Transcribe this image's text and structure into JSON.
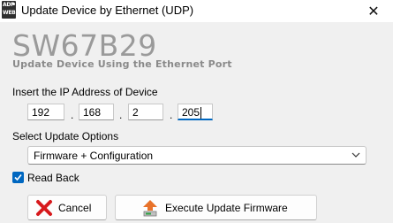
{
  "window": {
    "logo_line1": "ADF",
    "logo_line2": "WEB",
    "title": "Update Device by Ethernet (UDP)",
    "close_glyph": "✕"
  },
  "header": {
    "device": "SW67B29",
    "subtitle": "Update Device Using the Ethernet Port"
  },
  "ip": {
    "label": "Insert the IP Address of Device",
    "octets": [
      "192",
      "168",
      "2",
      "205"
    ],
    "separator": "."
  },
  "update_options": {
    "label": "Select Update Options",
    "selected": "Firmware + Configuration"
  },
  "read_back": {
    "label": "Read Back",
    "checked": true
  },
  "buttons": {
    "cancel": "Cancel",
    "execute": "Execute Update Firmware"
  },
  "colors": {
    "accent": "#0067c0",
    "cancel_icon": "#d7191c",
    "execute_icon": "#e8722a"
  },
  "icons": {
    "cancel": "red-x-icon",
    "execute": "upload-arrow-icon",
    "chevron": "chevron-down-icon",
    "check": "checkmark-icon"
  }
}
